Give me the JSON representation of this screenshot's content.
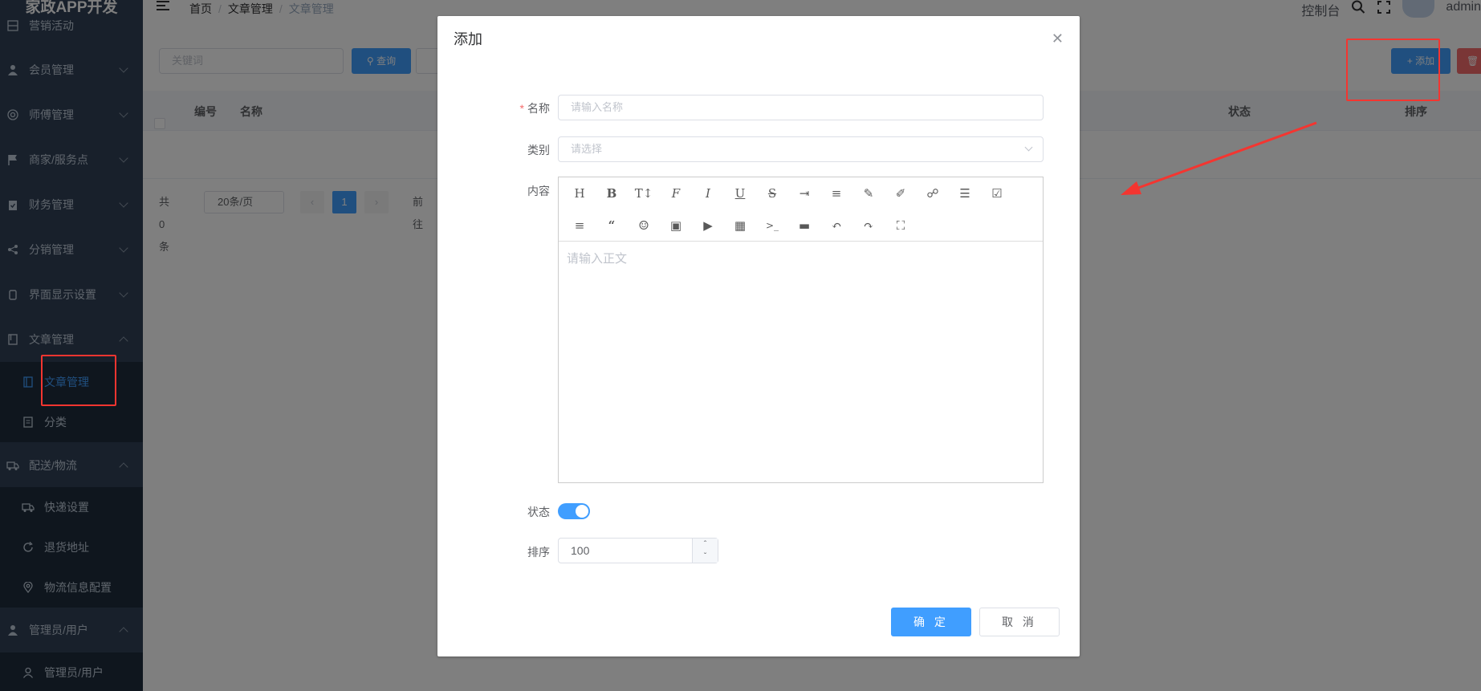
{
  "sidebar": {
    "logo": "家政APP开发",
    "items": [
      {
        "label": "营销活动"
      },
      {
        "label": "会员管理"
      },
      {
        "label": "师傅管理"
      },
      {
        "label": "商家/服务点"
      },
      {
        "label": "财务管理"
      },
      {
        "label": "分销管理"
      },
      {
        "label": "界面显示设置"
      },
      {
        "label": "文章管理"
      },
      {
        "label": "配送/物流"
      },
      {
        "label": "管理员/用户"
      }
    ],
    "sub_article": [
      {
        "label": "文章管理"
      },
      {
        "label": "分类"
      }
    ],
    "sub_logistics": [
      {
        "label": "快递设置"
      },
      {
        "label": "退货地址"
      },
      {
        "label": "物流信息配置"
      }
    ],
    "sub_admin": [
      {
        "label": "管理员/用户"
      }
    ]
  },
  "header": {
    "breadcrumb": [
      "首页",
      "文章管理",
      "文章管理"
    ],
    "console": "控制台",
    "user": "admin"
  },
  "main": {
    "search_placeholder": "关键词",
    "query_label": "查询",
    "add_label": "添加",
    "table_columns": {
      "id": "编号",
      "name": "名称",
      "status": "状态",
      "sort": "排序"
    },
    "pagination": {
      "total": "共 0 条",
      "page_size": "20条/页",
      "current": "1",
      "goto": "前往"
    }
  },
  "dialog": {
    "title": "添加",
    "name_label": "名称",
    "name_placeholder": "请输入名称",
    "category_label": "类别",
    "category_placeholder": "请选择",
    "content_label": "内容",
    "content_placeholder": "请输入正文",
    "status_label": "状态",
    "status_on": true,
    "sort_label": "排序",
    "sort_value": "100",
    "ok_label": "确 定",
    "cancel_label": "取 消"
  },
  "colors": {
    "primary": "#409eff",
    "sidebar": "#304156",
    "annotation": "#f43530"
  }
}
